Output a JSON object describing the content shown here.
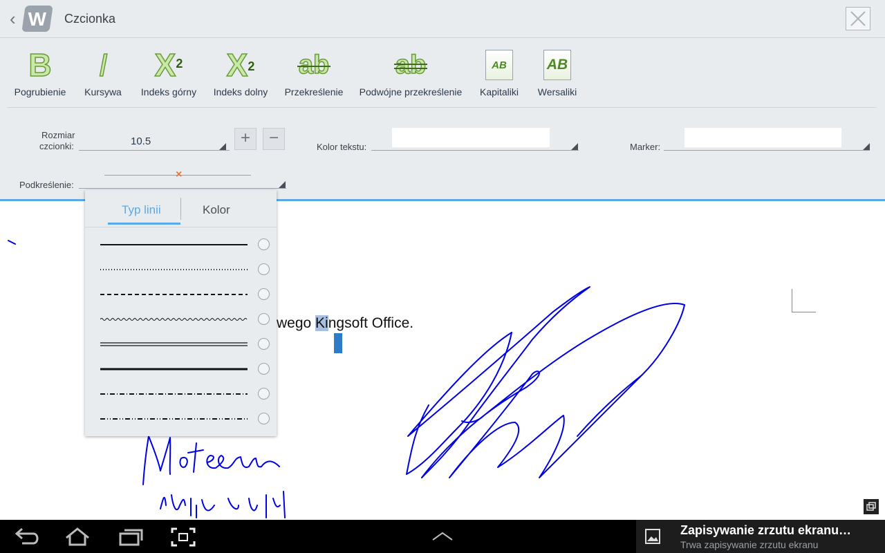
{
  "header": {
    "title": "Czcionka",
    "logo_letter": "W"
  },
  "toolbar": {
    "buttons": [
      {
        "label": "Pogrubienie",
        "icon": "bold-icon",
        "glyph": "B"
      },
      {
        "label": "Kursywa",
        "icon": "italic-icon",
        "glyph": "I"
      },
      {
        "label": "Indeks górny",
        "icon": "superscript-icon",
        "glyph": "X",
        "small": "2"
      },
      {
        "label": "Indeks dolny",
        "icon": "subscript-icon",
        "glyph": "X",
        "small": "2"
      },
      {
        "label": "Przekreślenie",
        "icon": "strikethrough-icon",
        "glyph": "ab"
      },
      {
        "label": "Podwójne przekreślenie",
        "icon": "double-strikethrough-icon",
        "glyph": "ab"
      },
      {
        "label": "Kapitaliki",
        "icon": "small-caps-icon",
        "glyph": "AB"
      },
      {
        "label": "Wersaliki",
        "icon": "all-caps-icon",
        "glyph": "AB"
      }
    ]
  },
  "font_size": {
    "label_line1": "Rozmiar",
    "label_line2": "czcionki:",
    "value": "10.5",
    "plus": "+",
    "minus": "−"
  },
  "text_color": {
    "label": "Kolor tekstu:",
    "value": ""
  },
  "marker": {
    "label": "Marker:",
    "value": ""
  },
  "underline": {
    "label": "Podkreślenie:",
    "current_marker": "×"
  },
  "dropdown": {
    "tabs": [
      "Typ linii",
      "Kolor"
    ],
    "active_tab": "Typ linii",
    "line_types": [
      "solid",
      "dotted",
      "dashed",
      "wavy",
      "double",
      "thick",
      "dash-dot",
      "dash-dot-dot"
    ]
  },
  "document": {
    "text_before": "wego ",
    "text_selected": "Ki",
    "text_after": "ngsoft Office."
  },
  "notification": {
    "title": "Zapisywanie zrzutu ekranu…",
    "subtitle": "Trwa zapisywanie zrzutu ekranu"
  },
  "colors": {
    "accent": "#5aa9e6",
    "panel_bg": "#e9ecef",
    "ink": "#0000e6",
    "selection": "#a9bfe0"
  }
}
